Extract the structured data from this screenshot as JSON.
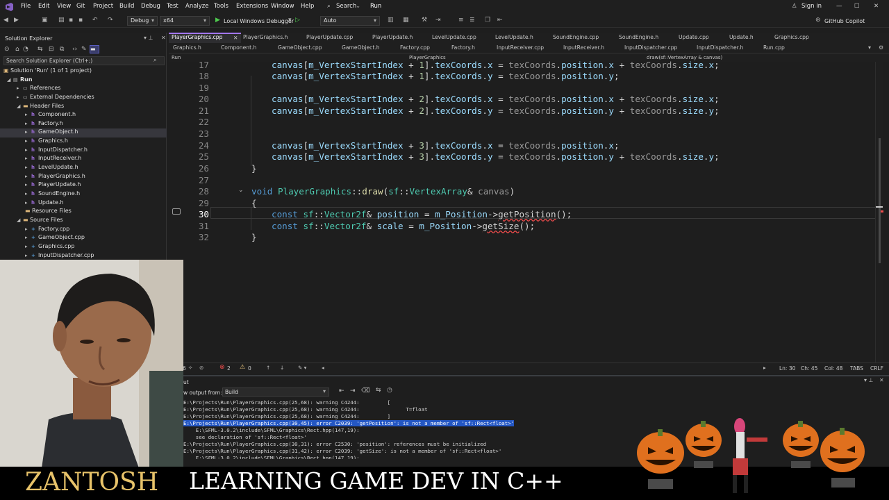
{
  "menu": [
    "File",
    "Edit",
    "View",
    "Git",
    "Project",
    "Build",
    "Debug",
    "Test",
    "Analyze",
    "Tools",
    "Extensions",
    "Window",
    "Help"
  ],
  "search_label": "Search",
  "solution_name_top": "Run",
  "sign_in": "Sign in",
  "copilot": "GitHub Copilot",
  "toolbar": {
    "config": "Debug",
    "platform": "x64",
    "debugger": "Local Windows Debugger",
    "auto": "Auto"
  },
  "solution_explorer": {
    "title": "Solution Explorer",
    "search_placeholder": "Search Solution Explorer (Ctrl+;)",
    "items": [
      {
        "label": "Solution 'Run' (1 of 1 project)",
        "icon": "solution-icon"
      },
      {
        "label": "Run",
        "icon": "project-icon"
      },
      {
        "label": "References",
        "icon": "references-icon"
      },
      {
        "label": "External Dependencies",
        "icon": "external-deps-icon"
      },
      {
        "label": "Header Files",
        "icon": "folder-icon"
      },
      {
        "label": "Component.h",
        "icon": "header-file-icon"
      },
      {
        "label": "Factory.h",
        "icon": "header-file-icon"
      },
      {
        "label": "GameObject.h",
        "icon": "header-file-icon"
      },
      {
        "label": "Graphics.h",
        "icon": "header-file-icon"
      },
      {
        "label": "InputDispatcher.h",
        "icon": "header-file-icon"
      },
      {
        "label": "InputReceiver.h",
        "icon": "header-file-icon"
      },
      {
        "label": "LevelUpdate.h",
        "icon": "header-file-icon"
      },
      {
        "label": "PlayerGraphics.h",
        "icon": "header-file-icon"
      },
      {
        "label": "PlayerUpdate.h",
        "icon": "header-file-icon"
      },
      {
        "label": "SoundEngine.h",
        "icon": "header-file-icon"
      },
      {
        "label": "Update.h",
        "icon": "header-file-icon"
      },
      {
        "label": "Resource Files",
        "icon": "folder-icon"
      },
      {
        "label": "Source Files",
        "icon": "folder-icon"
      },
      {
        "label": "Factory.cpp",
        "icon": "cpp-file-icon"
      },
      {
        "label": "GameObject.cpp",
        "icon": "cpp-file-icon"
      },
      {
        "label": "Graphics.cpp",
        "icon": "cpp-file-icon"
      },
      {
        "label": "InputDispatcher.cpp",
        "icon": "cpp-file-icon"
      }
    ]
  },
  "tabs_row1": [
    "PlayerGraphics.cpp",
    "PlayerGraphics.h",
    "PlayerUpdate.cpp",
    "PlayerUpdate.h",
    "LevelUpdate.cpp",
    "LevelUpdate.h",
    "SoundEngine.cpp",
    "SoundEngine.h",
    "Update.cpp",
    "Update.h",
    "Graphics.cpp"
  ],
  "tabs_row2": [
    "Graphics.h",
    "Component.h",
    "GameObject.cpp",
    "GameObject.h",
    "Factory.cpp",
    "Factory.h",
    "InputReceiver.cpp",
    "InputReceiver.h",
    "InputDispatcher.cpp",
    "InputDispatcher.h",
    "Run.cpp"
  ],
  "nav": {
    "project": "Run",
    "class": "PlayerGraphics",
    "member": "draw(sf::VertexArray & canvas)"
  },
  "code_lines": [
    {
      "n": "17",
      "text": "canvas[m_VertexStartIndex + 1].texCoords.x = texCoords.position.x + texCoords.size.x;"
    },
    {
      "n": "18",
      "text": "canvas[m_VertexStartIndex + 1].texCoords.y = texCoords.position.y;"
    },
    {
      "n": "19",
      "text": ""
    },
    {
      "n": "20",
      "text": "canvas[m_VertexStartIndex + 2].texCoords.x = texCoords.position.x + texCoords.size.x;"
    },
    {
      "n": "21",
      "text": "canvas[m_VertexStartIndex + 2].texCoords.y = texCoords.position.y + texCoords.size.y;"
    },
    {
      "n": "22",
      "text": ""
    },
    {
      "n": "23",
      "text": ""
    },
    {
      "n": "24",
      "text": "canvas[m_VertexStartIndex + 3].texCoords.x = texCoords.position.x;"
    },
    {
      "n": "25",
      "text": "canvas[m_VertexStartIndex + 3].texCoords.y = texCoords.position.y + texCoords.size.y;"
    },
    {
      "n": "26",
      "text": "}"
    },
    {
      "n": "27",
      "text": ""
    },
    {
      "n": "28",
      "text": "void PlayerGraphics::draw(sf::VertexArray& canvas)"
    },
    {
      "n": "29",
      "text": "{"
    },
    {
      "n": "30",
      "text": "const sf::Vector2f& position = m_Position->getPosition();"
    },
    {
      "n": "31",
      "text": "const sf::Vector2f& scale = m_Position->getSize();"
    },
    {
      "n": "32",
      "text": "}"
    }
  ],
  "status": {
    "zoom": "6",
    "errors": "2",
    "warnings": "0",
    "line": "Ln: 30",
    "char": "Ch: 45",
    "col": "Col: 48",
    "tabs": "TABS",
    "eol": "CRLF"
  },
  "output": {
    "title": "Output",
    "show_from_label": "w output from:",
    "source": "Build",
    "lines": [
      {
        "text": "E:\\Projects\\Run\\PlayerGraphics.cpp(25,68): warning C4244:         [",
        "hl": false
      },
      {
        "text": "E:\\Projects\\Run\\PlayerGraphics.cpp(25,68): warning C4244:               T=float",
        "hl": false
      },
      {
        "text": "E:\\Projects\\Run\\PlayerGraphics.cpp(25,68): warning C4244:         ]",
        "hl": false
      },
      {
        "text": "E:\\Projects\\Run\\PlayerGraphics.cpp(30,45): error C2039: 'getPosition': is not a member of 'sf::Rect<float>'",
        "hl": true
      },
      {
        "text": "    E:\\SFML-3.0.2\\include\\SFML\\Graphics\\Rect.hpp(147,19):",
        "hl": false
      },
      {
        "text": "    see declaration of 'sf::Rect<float>'",
        "hl": false
      },
      {
        "text": "E:\\Projects\\Run\\PlayerGraphics.cpp(30,31): error C2530: 'position': references must be initialized",
        "hl": false
      },
      {
        "text": "E:\\Projects\\Run\\PlayerGraphics.cpp(31,42): error C2039: 'getSize': is not a member of 'sf::Rect<float>'",
        "hl": false
      },
      {
        "text": "    E:\\SFML-3.0.2\\include\\SFML\\Graphics\\Rect.hpp(147,19):",
        "hl": false
      }
    ]
  },
  "banner": {
    "logo": "ZANTOSH",
    "title": "LEARNING GAME DEV IN C++"
  }
}
